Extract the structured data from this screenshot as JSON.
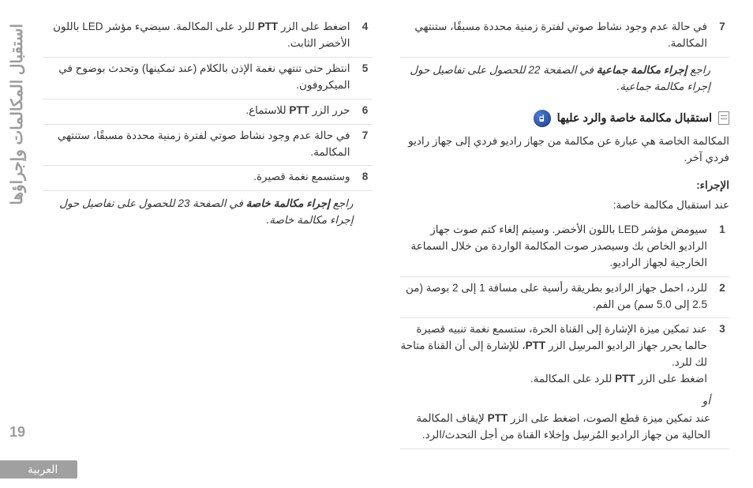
{
  "sidebar_title": "استقبال المكالمات وإجراؤها",
  "page_number": "19",
  "lang_label": "العربية",
  "right": {
    "step7": "في حالة عدم وجود نشاط صوتي لفترة زمنية محددة مسبقًا، ستنتهي المكالمة.",
    "groupcall_ref_pre": "راجع ",
    "groupcall_ref_bold": "إجراء مكالمة جماعية",
    "groupcall_ref_post": " في الصفحة 22 للحصول على تفاصيل حول إجراء مكالمة جماعية.",
    "priv_heading": "استقبال مكالمة خاصة والرد عليها",
    "priv_intro": "المكالمة الخاصة هي عبارة عن مكالمة من جهاز راديو فردي إلى جهاز راديو فردي آخر.",
    "procedure_label": "الإجراء:",
    "priv_when": "عند استقبال مكالمة خاصة:",
    "step1": "سيومض مؤشر LED باللون الأخضر. وسيتم إلغاء كتم صوت جهاز الراديو الخاص بك وسيصدر صوت المكالمة الواردة من خلال السماعة الخارجية لجهاز الراديو.",
    "step2": "للرد، احمل جهاز الراديو بطريقة رأسية على مسافة 1 إلى 2 بوصة (من 2.5 إلى 5.0 سم) من الفم.",
    "step3a_pre": "عند تمكين ميزة الإشارة إلى القناة الحرة، ستسمع نغمة تنبيه قصيرة حالما يحرر جهاز الراديو المرسِل الزر ",
    "step3a_ptt": "PTT",
    "step3a_mid": "، للإشارة إلى أن القناة متاحة لك للرد.",
    "step3a_press_pre": "اضغط على الزر ",
    "step3a_press_post": " للرد على المكالمة.",
    "or_text": "أو",
    "step3b_pre": "عند تمكين ميزة قطع الصوت، اضغط على الزر ",
    "step3b_post": " لإيقاف المكالمة الحالية من جهاز الراديو المُرسِل وإخلاء القناة من أجل التحدث/الرد."
  },
  "left": {
    "step4_pre": "اضغط على الزر ",
    "ptt": "PTT",
    "step4_post": " للرد على المكالمة. سيضيء مؤشر LED باللون الأخضر الثابت.",
    "step5": "انتظر حتى تنتهي نغمة الإذن بالكلام (عند تمكينها) وتحدث بوضوح في الميكروفون.",
    "step6_pre": "حرر الزر ",
    "step6_post": " للاستماع.",
    "step7": "في حالة عدم وجود نشاط صوتي لفترة زمنية محددة مسبقًا، ستنتهي المكالمة.",
    "step8": "وستسمع نغمة قصيرة.",
    "privcall_ref_pre": "راجع ",
    "privcall_ref_bold": "إجراء مكالمة خاصة",
    "privcall_ref_post": " في الصفحة 23 للحصول على تفاصيل حول إجراء مكالمة خاصة."
  }
}
